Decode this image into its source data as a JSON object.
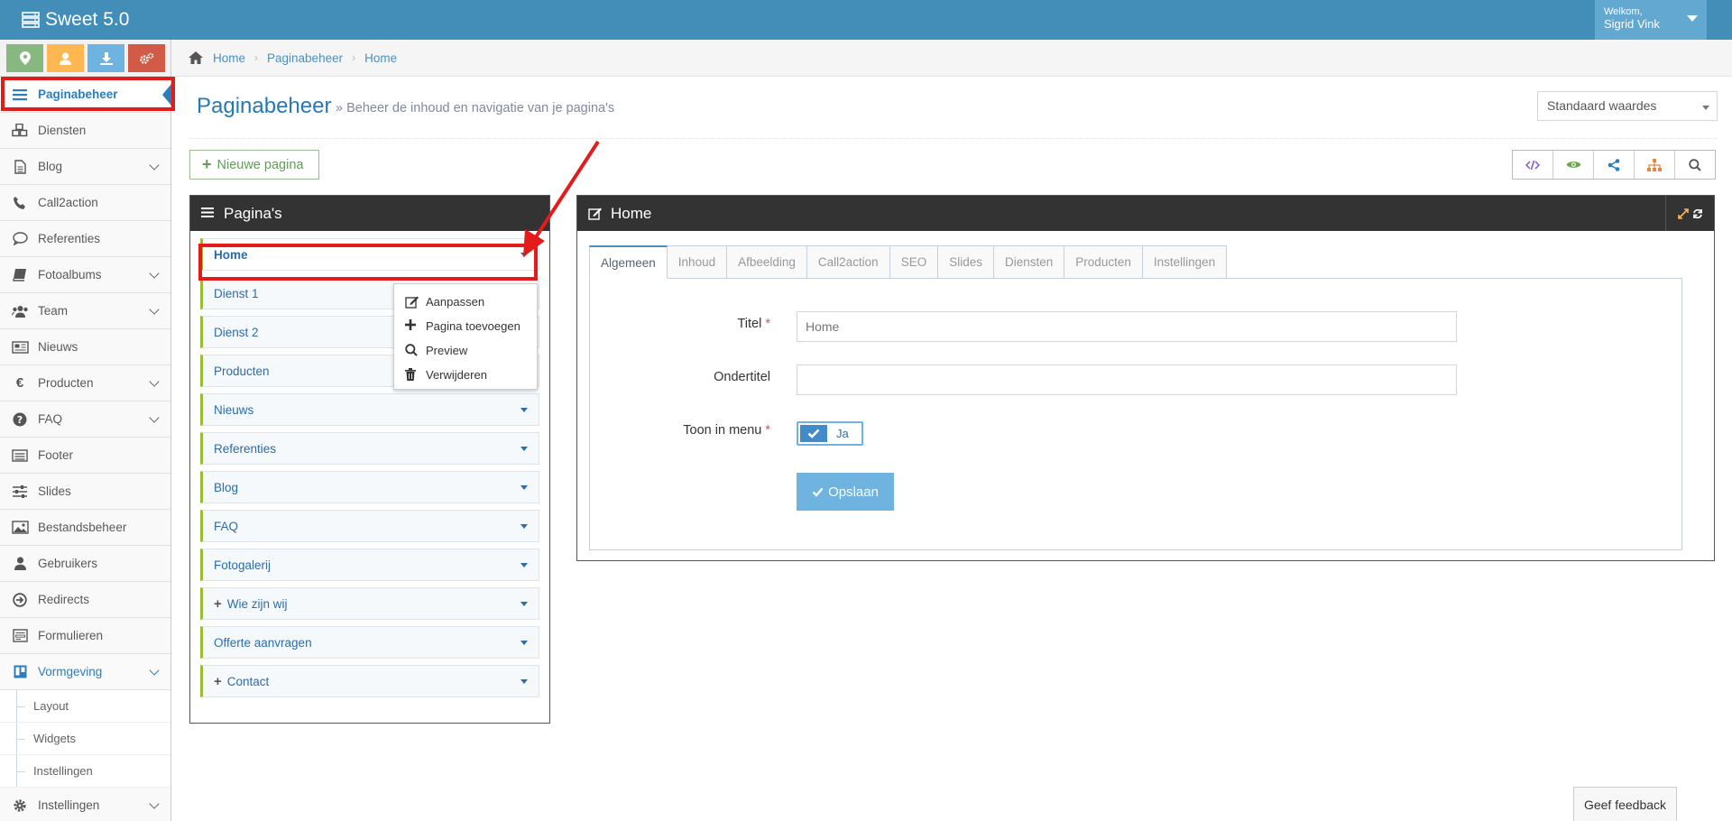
{
  "app": {
    "title": "Sweet 5.0",
    "welcome": "Welkom,",
    "user_name": "Sigrid Vink"
  },
  "shortcuts": [
    {
      "icon": "map-marker-icon",
      "color": "#87b87f"
    },
    {
      "icon": "user-icon",
      "color": "#ffb752"
    },
    {
      "icon": "download-icon",
      "color": "#6fb3e0"
    },
    {
      "icon": "cogs-icon",
      "color": "#d15b47"
    }
  ],
  "sidebar": {
    "items": [
      {
        "label": "Paginabeheer",
        "icon": "bars-icon",
        "active": true
      },
      {
        "label": "Diensten",
        "icon": "cubes-icon"
      },
      {
        "label": "Blog",
        "icon": "file-text-icon",
        "has_children": true
      },
      {
        "label": "Call2action",
        "icon": "phone-icon"
      },
      {
        "label": "Referenties",
        "icon": "comment-icon"
      },
      {
        "label": "Fotoalbums",
        "icon": "book-icon",
        "has_children": true
      },
      {
        "label": "Team",
        "icon": "users-icon",
        "has_children": true
      },
      {
        "label": "Nieuws",
        "icon": "newspaper-icon"
      },
      {
        "label": "Producten",
        "icon": "euro-icon",
        "has_children": true
      },
      {
        "label": "FAQ",
        "icon": "question-circle-icon",
        "has_children": true
      },
      {
        "label": "Footer",
        "icon": "list-alt-icon"
      },
      {
        "label": "Slides",
        "icon": "sliders-icon"
      },
      {
        "label": "Bestandsbeheer",
        "icon": "image-icon"
      },
      {
        "label": "Gebruikers",
        "icon": "user-icon"
      },
      {
        "label": "Redirects",
        "icon": "arrow-circle-icon"
      },
      {
        "label": "Formulieren",
        "icon": "form-icon"
      },
      {
        "label": "Vormgeving",
        "icon": "trello-icon",
        "has_children": true,
        "open": true
      },
      {
        "label": "Instellingen",
        "icon": "cog-icon",
        "has_children": true
      }
    ],
    "vormgeving_children": [
      "Layout",
      "Widgets",
      "Instellingen"
    ]
  },
  "breadcrumb": [
    "Home",
    "Paginabeheer",
    "Home"
  ],
  "header": {
    "title": "Paginabeheer",
    "subtitle": "» Beheer de inhoud en navigatie van je pagina's",
    "select_value": "Standaard waardes"
  },
  "toolbar": {
    "new_page_label": "Nieuwe pagina",
    "icons": [
      "code-icon",
      "eye-icon",
      "share-icon",
      "sitemap-icon",
      "search-icon"
    ],
    "icon_colors": [
      "#7e57c2",
      "#69aa46",
      "#2b7dbc",
      "#e8853f",
      "#555555"
    ]
  },
  "pages_panel": {
    "title": "Pagina's",
    "pages": [
      {
        "label": "Home",
        "expandable": false
      },
      {
        "label": "Dienst 1",
        "expandable": false
      },
      {
        "label": "Dienst 2",
        "expandable": false
      },
      {
        "label": "Producten",
        "expandable": false
      },
      {
        "label": "Nieuws",
        "expandable": false
      },
      {
        "label": "Referenties",
        "expandable": false
      },
      {
        "label": "Blog",
        "expandable": false
      },
      {
        "label": "FAQ",
        "expandable": false
      },
      {
        "label": "Fotogalerij",
        "expandable": false
      },
      {
        "label": "Wie zijn wij",
        "expandable": true
      },
      {
        "label": "Offerte aanvragen",
        "expandable": false
      },
      {
        "label": "Contact",
        "expandable": true
      }
    ],
    "context_menu": [
      "Aanpassen",
      "Pagina toevoegen",
      "Preview",
      "Verwijderen"
    ]
  },
  "edit_panel": {
    "title": "Home",
    "tabs": [
      "Algemeen",
      "Inhoud",
      "Afbeelding",
      "Call2action",
      "SEO",
      "Slides",
      "Diensten",
      "Producten",
      "Instellingen"
    ],
    "active_tab": "Algemeen",
    "fields": {
      "titel_label": "Titel",
      "titel_placeholder": "Home",
      "ondertitel_label": "Ondertitel",
      "ondertitel_value": "",
      "menu_label": "Toon in menu",
      "menu_toggle": "Ja",
      "required_mark": "*"
    },
    "save_label": "Opslaan"
  },
  "feedback_label": "Geef feedback",
  "colors": {
    "topbar": "#438eb9",
    "accent": "#2b7dbc",
    "annotation_red": "#e41b1b",
    "page_item_border": "#9abc32"
  }
}
